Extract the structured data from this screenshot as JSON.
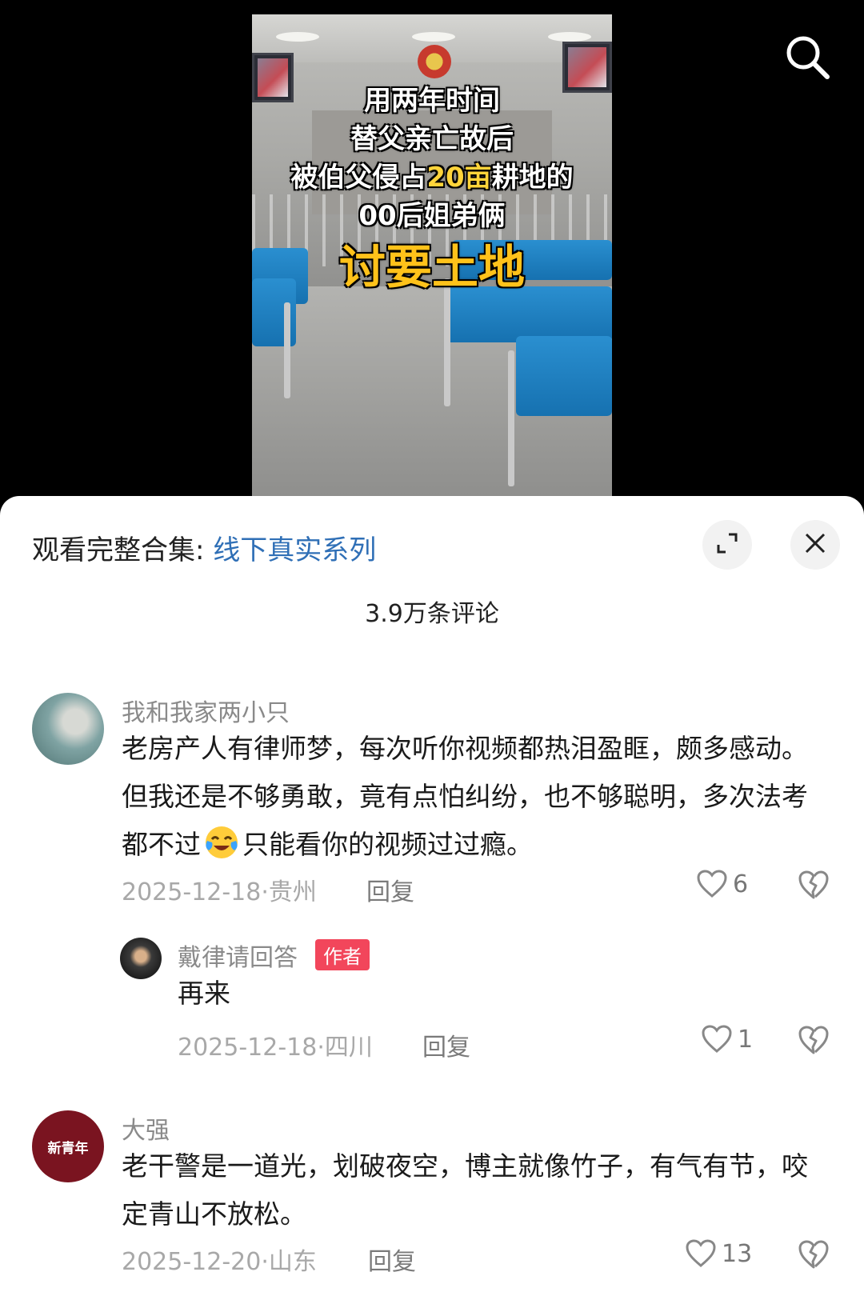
{
  "video": {
    "overlay": {
      "line1": "用两年时间",
      "line2": "替父亲亡故后",
      "line3_before": "被伯父侵占",
      "line3_highlight": "20亩",
      "line3_after": "耕地的",
      "line4": "00后姐弟俩",
      "line5": "讨要土地"
    },
    "search_icon": "search-icon"
  },
  "sheet": {
    "collection_prefix": "观看完整合集: ",
    "collection_link": "线下真实系列",
    "expand_icon": "expand-icon",
    "close_icon": "close-icon",
    "comment_count": "3.9万条评论"
  },
  "comments": [
    {
      "user": "我和我家两小只",
      "text_part1": "老房产人有律师梦，每次听你视频都热泪盈眶，颇多感动。但我还是不够勇敢，竟有点怕纠纷，也不够聪明，多次法考都不过",
      "emoji": "crying-laughing-emoji",
      "text_part2": "只能看你的视频过过瘾。",
      "date": "2025-12-18",
      "location": "贵州",
      "reply_label": "回复",
      "likes": "6"
    },
    {
      "user": "戴律请回答",
      "badge": "作者",
      "text": "再来",
      "date": "2025-12-18",
      "location": "四川",
      "reply_label": "回复",
      "likes": "1"
    },
    {
      "user": "大强",
      "avatar_text": "新青年",
      "text": "老干警是一道光，划破夜空，博主就像竹子，有气有节，咬定青山不放松。",
      "date": "2025-12-20",
      "location": "山东",
      "reply_label": "回复",
      "likes": "13"
    }
  ],
  "colors": {
    "link": "#2f6fb6",
    "author_badge": "#f2465b",
    "overlay_highlight": "#ffd43a",
    "overlay_big": "#ffc21a"
  }
}
